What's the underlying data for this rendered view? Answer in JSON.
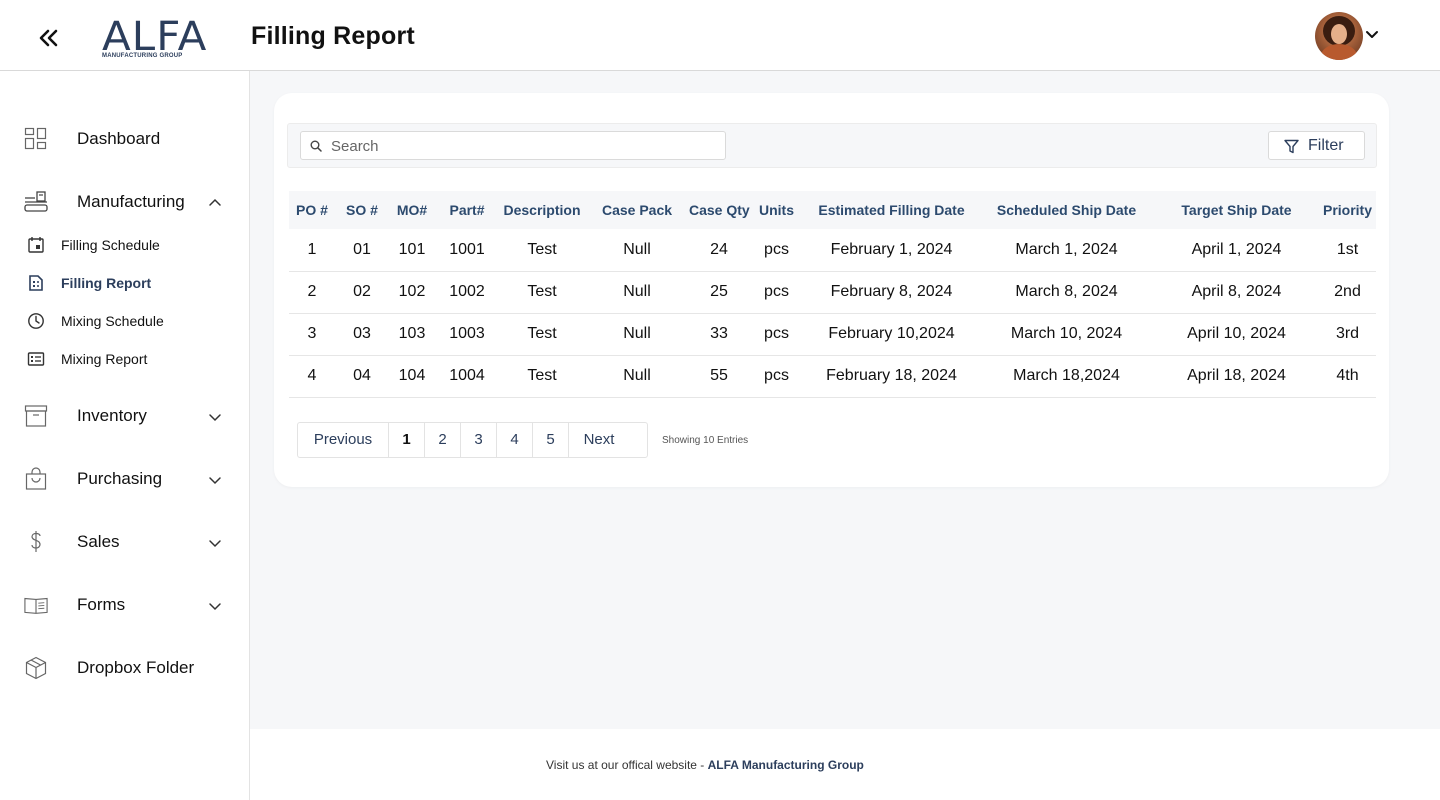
{
  "header": {
    "logo_text": "ALFA",
    "logo_subtext": "MANUFACTURING GROUP",
    "page_title": "Filling Report"
  },
  "sidebar": {
    "items": [
      {
        "label": "Dashboard",
        "icon": "dashboard-grid-icon"
      },
      {
        "label": "Manufacturing",
        "icon": "manufacturing-icon",
        "expanded": true
      },
      {
        "label": "Inventory",
        "icon": "archive-box-icon"
      },
      {
        "label": "Purchasing",
        "icon": "shopping-bag-icon"
      },
      {
        "label": "Sales",
        "icon": "dollar-icon"
      },
      {
        "label": "Forms",
        "icon": "open-book-icon"
      },
      {
        "label": "Dropbox Folder",
        "icon": "package-box-icon"
      }
    ],
    "manufacturing_sub": [
      {
        "label": "Filling Schedule",
        "icon": "calendar-icon"
      },
      {
        "label": "Filling Report",
        "icon": "report-icon",
        "active": true
      },
      {
        "label": "Mixing Schedule",
        "icon": "clock-icon"
      },
      {
        "label": "Mixing Report",
        "icon": "list-card-icon"
      }
    ]
  },
  "toolbar": {
    "search_placeholder": "Search",
    "filter_label": "Filter"
  },
  "table": {
    "columns": [
      "PO #",
      "SO #",
      "MO#",
      "Part#",
      "Description",
      "Case Pack",
      "Case Qty",
      "Units",
      "Estimated Filling Date",
      "Scheduled Ship Date",
      "Target Ship Date",
      "Priority"
    ],
    "rows": [
      [
        "1",
        "01",
        "101",
        "1001",
        "Test",
        "Null",
        "24",
        "pcs",
        "February 1, 2024",
        "March 1, 2024",
        "April 1, 2024",
        "1st"
      ],
      [
        "2",
        "02",
        "102",
        "1002",
        "Test",
        "Null",
        "25",
        "pcs",
        "February 8, 2024",
        "March 8, 2024",
        "April 8, 2024",
        "2nd"
      ],
      [
        "3",
        "03",
        "103",
        "1003",
        "Test",
        "Null",
        "33",
        "pcs",
        "February 10,2024",
        "March 10, 2024",
        "April 10, 2024",
        "3rd"
      ],
      [
        "4",
        "04",
        "104",
        "1004",
        "Test",
        "Null",
        "55",
        "pcs",
        "February 18, 2024",
        "March 18,2024",
        "April 18, 2024",
        "4th"
      ]
    ]
  },
  "pagination": {
    "previous": "Previous",
    "pages": [
      "1",
      "2",
      "3",
      "4",
      "5"
    ],
    "current": "1",
    "next": "Next",
    "entries_text": "Showing 10 Entries"
  },
  "footer": {
    "text": "Visit us at our offical website - ",
    "link": "ALFA Manufacturing Group"
  },
  "colors": {
    "brand_navy": "#2c3e5c",
    "header_text": "#2c4a6e",
    "main_bg": "#f6f7f9"
  }
}
